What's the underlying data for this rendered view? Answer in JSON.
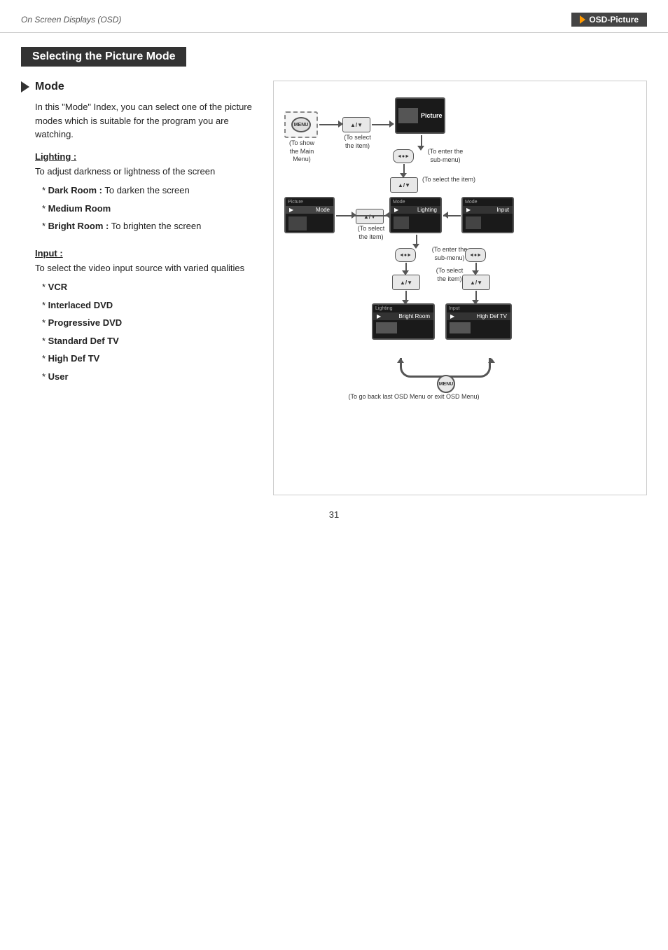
{
  "header": {
    "left_text": "On Screen Displays (OSD)",
    "right_text": "OSD-Picture"
  },
  "section": {
    "title": "Selecting the Picture Mode"
  },
  "mode": {
    "heading": "Mode",
    "intro": "In this \"Mode\" Index, you can select one of the picture modes which is suitable for the program you are watching.",
    "lighting": {
      "title": "Lighting :",
      "desc": "To adjust darkness or lightness of the screen",
      "items": [
        "* Dark Room : To darken the screen",
        "* Medium Room",
        "* Bright Room : To brighten the screen"
      ]
    },
    "input": {
      "title": "Input :",
      "desc": "To select the video input source with varied qualities",
      "items": [
        "* VCR",
        "* Interlaced DVD",
        "* Progressive DVD",
        "* Standard Def TV",
        "* High Def TV",
        "* User"
      ]
    }
  },
  "diagram": {
    "captions": {
      "show_main_menu": "(To show\nthe Main\nMenu)",
      "select_item": "(To select\nthe item)",
      "enter_submenu1": "(To enter the\nsub-menu)",
      "select_item2": "(To select the item)",
      "enter_submenu2": "(To enter the\nsub-menu)",
      "select_item3": "(To select\nthe item)",
      "enter_submenu3": "(To enter the\nsub-menu)",
      "select_item4": "(To select\nthe item)",
      "enter_submenu4": "(To enter the\nsub-menu)",
      "select_item5": "(To select\nthe item)",
      "back_exit": "(To go back last OSD Menu or exit OSD Menu)"
    },
    "screens": {
      "picture_label": "Picture",
      "mode_label": "Mode",
      "lighting_label": "Lighting",
      "input_label": "Input",
      "bright_room_label": "Bright Room",
      "high_def_tv_label": "High Def TV"
    }
  },
  "page_number": "31"
}
